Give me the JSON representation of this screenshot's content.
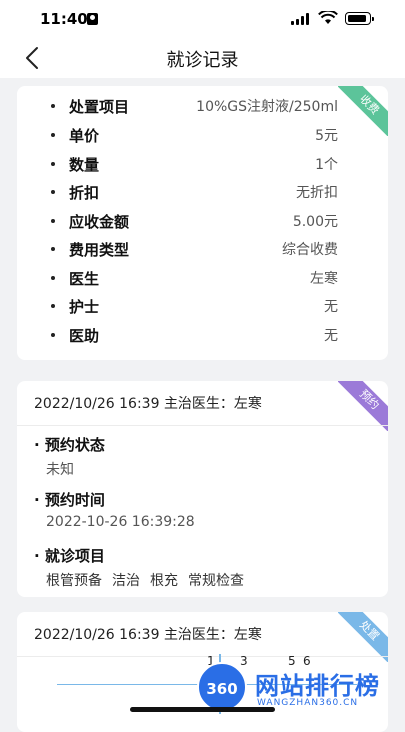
{
  "status_bar": {
    "time": "11:40"
  },
  "nav": {
    "title": "就诊记录"
  },
  "card1": {
    "badge": "收费",
    "badge_color": "#5cc49a",
    "items": [
      {
        "label": "处置项目",
        "value": "10%GS注射液/250ml"
      },
      {
        "label": "单价",
        "value": "5元"
      },
      {
        "label": "数量",
        "value": "1个"
      },
      {
        "label": "折扣",
        "value": "无折扣"
      },
      {
        "label": "应收金额",
        "value": "5.00元"
      },
      {
        "label": "费用类型",
        "value": "综合收费"
      },
      {
        "label": "医生",
        "value": "左寒"
      },
      {
        "label": "护士",
        "value": "无"
      },
      {
        "label": "医助",
        "value": "无"
      }
    ]
  },
  "card2": {
    "badge": "预约",
    "badge_color": "#9b7ad8",
    "header": "2022/10/26 16:39  主治医生：左寒",
    "status_label": "· 预约状态",
    "status_value": "未知",
    "time_label": "· 预约时间",
    "time_value": "2022-10-26 16:39:28",
    "items_label": "· 就诊项目",
    "items": [
      "根管预备",
      "洁治",
      "根充",
      "常规检查"
    ]
  },
  "card3": {
    "badge": "处置",
    "badge_color": "#7ab8e8",
    "header": "2022/10/26 16:39  主治医生：左寒",
    "tooth_numbers": [
      "1",
      "3",
      "5",
      "6"
    ]
  },
  "watermark": {
    "circle": "360",
    "title": "网站排行榜",
    "subtitle": "WANGZHAN360.CN"
  }
}
